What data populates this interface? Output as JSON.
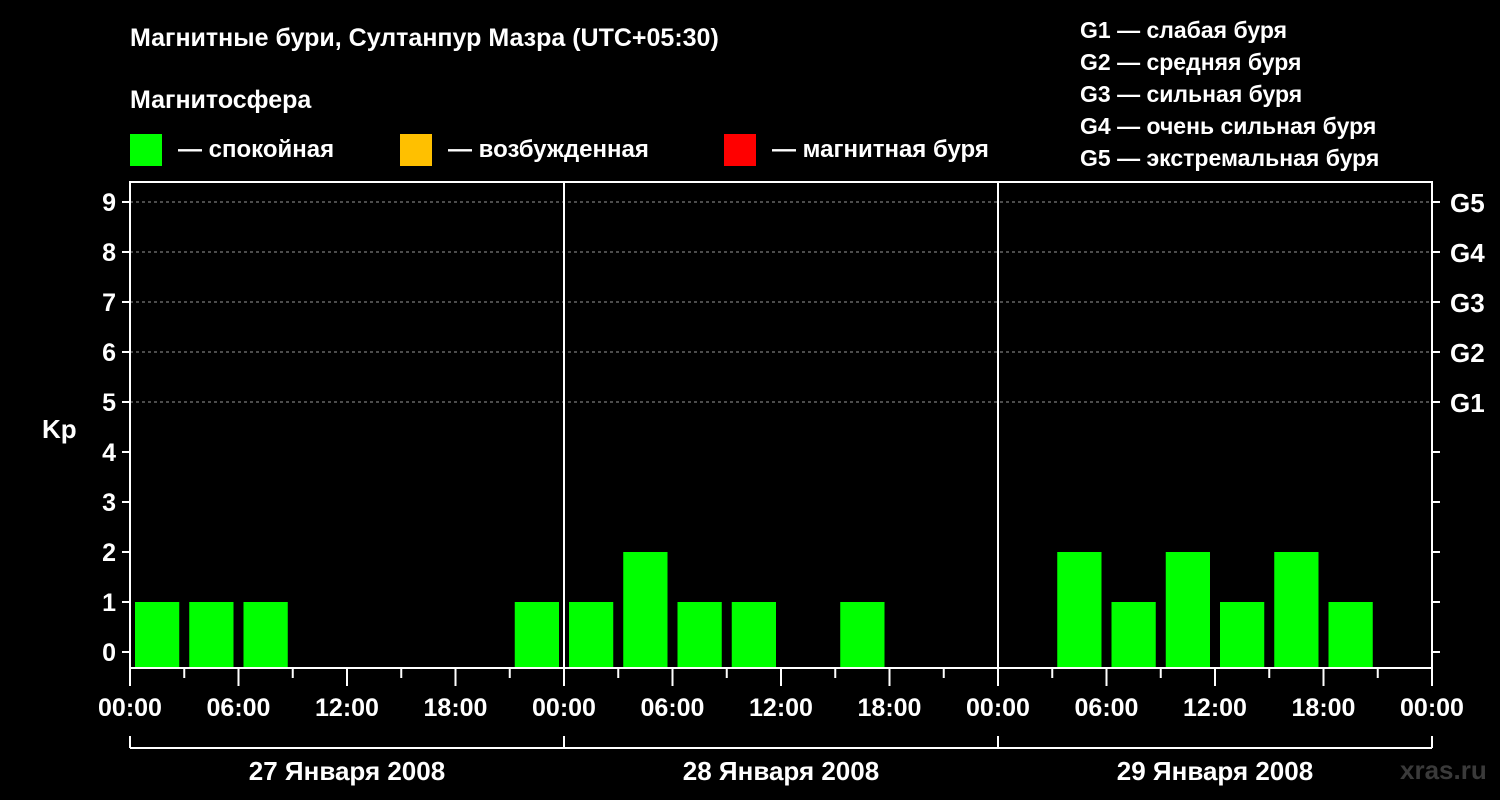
{
  "title": "Магнитные бури, Султанпур Мазра (UTC+05:30)",
  "magnetosphere_label": "Магнитосфера",
  "legend": [
    {
      "color": "#00ff00",
      "label": "— спокойная"
    },
    {
      "color": "#ffc000",
      "label": "— возбужденная"
    },
    {
      "color": "#ff0000",
      "label": "— магнитная буря"
    }
  ],
  "storm_levels": [
    "G1 — слабая буря",
    "G2 — средняя буря",
    "G3 — сильная буря",
    "G4 — очень сильная буря",
    "G5 — экстремальная буря"
  ],
  "watermark": "xras.ru",
  "chart_data": {
    "type": "bar",
    "ylabel": "Kp",
    "ylim": [
      0,
      9
    ],
    "y_ticks": [
      "0",
      "1",
      "2",
      "3",
      "4",
      "5",
      "6",
      "7",
      "8",
      "9"
    ],
    "right_ticks": [
      {
        "kp": 5,
        "label": "G1"
      },
      {
        "kp": 6,
        "label": "G2"
      },
      {
        "kp": 7,
        "label": "G3"
      },
      {
        "kp": 8,
        "label": "G4"
      },
      {
        "kp": 9,
        "label": "G5"
      }
    ],
    "x_tick_labels": [
      "00:00",
      "06:00",
      "12:00",
      "18:00",
      "00:00",
      "06:00",
      "12:00",
      "18:00",
      "00:00",
      "06:00",
      "12:00",
      "18:00",
      "00:00",
      "06:00",
      "12:00",
      "18:00",
      "00:00"
    ],
    "days": [
      "27 Января 2008",
      "28 Января 2008",
      "29 Января 2008"
    ],
    "bar_color": "#00ff00",
    "bars": [
      {
        "start_hour": 0,
        "kp": 1
      },
      {
        "start_hour": 3,
        "kp": 1
      },
      {
        "start_hour": 6,
        "kp": 1
      },
      {
        "start_hour": 9,
        "kp": 0
      },
      {
        "start_hour": 12,
        "kp": 0
      },
      {
        "start_hour": 15,
        "kp": 0
      },
      {
        "start_hour": 18,
        "kp": 0
      },
      {
        "start_hour": 21,
        "kp": 1
      },
      {
        "start_hour": 24,
        "kp": 1
      },
      {
        "start_hour": 27,
        "kp": 2
      },
      {
        "start_hour": 30,
        "kp": 1
      },
      {
        "start_hour": 33,
        "kp": 1
      },
      {
        "start_hour": 36,
        "kp": 0
      },
      {
        "start_hour": 39,
        "kp": 1
      },
      {
        "start_hour": 42,
        "kp": 0
      },
      {
        "start_hour": 45,
        "kp": 0
      },
      {
        "start_hour": 48,
        "kp": 0
      },
      {
        "start_hour": 51,
        "kp": 2
      },
      {
        "start_hour": 54,
        "kp": 1
      },
      {
        "start_hour": 57,
        "kp": 2
      },
      {
        "start_hour": 60,
        "kp": 1
      },
      {
        "start_hour": 63,
        "kp": 2
      },
      {
        "start_hour": 66,
        "kp": 1
      },
      {
        "start_hour": 69,
        "kp": 0
      }
    ]
  }
}
